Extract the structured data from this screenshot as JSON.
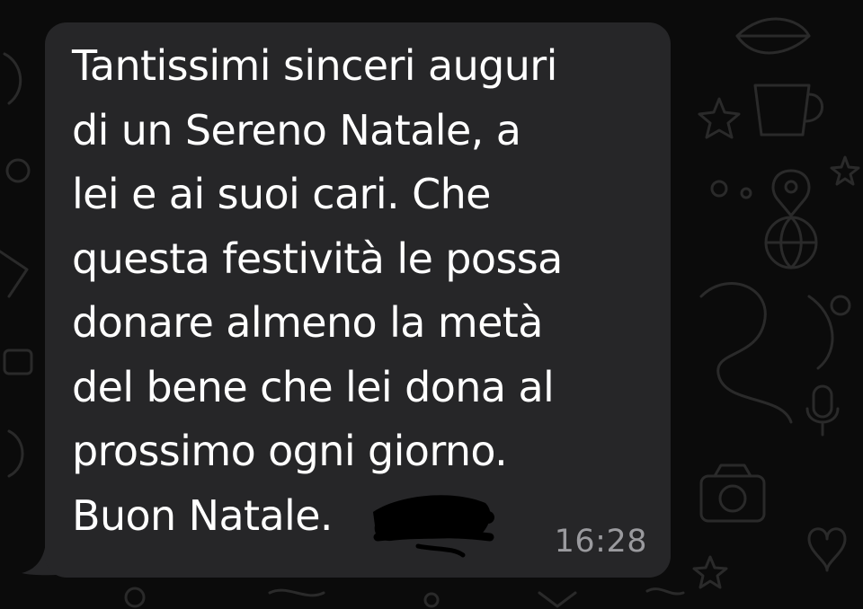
{
  "message": {
    "text": "Tantissimi sinceri auguri\ndi un Sereno Natale, a\nlei e ai suoi cari. Che\nquesta festività le possa\ndonare almeno la metà\ndel bene che lei dona al\nprossimo ogni giorno.\nBuon Natale.",
    "time": "16:28"
  },
  "colors": {
    "background": "#0b0b0b",
    "bubble": "#262628",
    "text": "#ffffff",
    "timestamp": "#9a9a9e",
    "redaction_ink": "#000000"
  },
  "icons": [
    "leaf-doodle-icon",
    "coffee-cup-doodle-icon",
    "star-doodle-icon",
    "location-pin-doodle-icon",
    "basketball-doodle-icon",
    "microphone-doodle-icon",
    "camera-doodle-icon",
    "heart-doodle-icon"
  ]
}
